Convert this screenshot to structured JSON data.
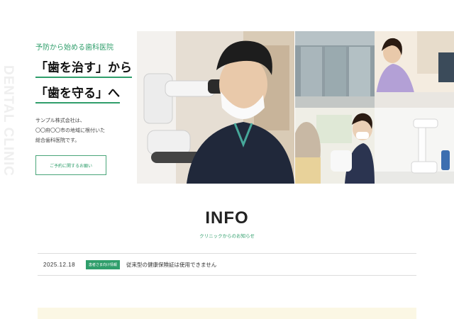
{
  "side_vertical_text": "DENTAL CLINIC",
  "hero": {
    "tagline": "予防から始める歯科医院",
    "headline_line1": "「歯を治す」から",
    "headline_line2": "「歯を守る」へ",
    "description": [
      "サンプル株式会社は、",
      "〇〇府〇〇市の地域に根付いた",
      "総合歯科医院です。"
    ],
    "appointment_button": "ご予約に関するお願い"
  },
  "info": {
    "title": "INFO",
    "subtitle": "クリニックからのお知らせ",
    "news": [
      {
        "date": "2025.12.18",
        "category": "患者さま向け情報",
        "title": "従来型の健康保険証は使用できません"
      }
    ]
  },
  "colors": {
    "accent": "#2f9e6b",
    "banner_bg": "#fbf7e4"
  }
}
